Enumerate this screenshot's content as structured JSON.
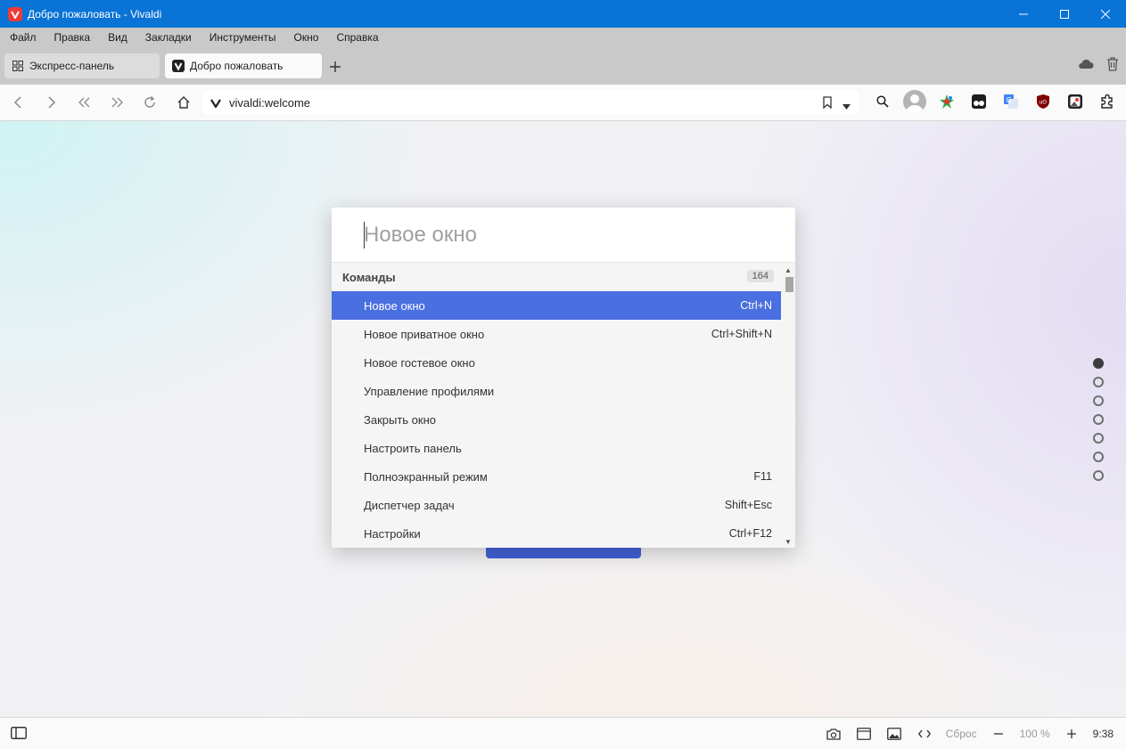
{
  "window": {
    "title": "Добро пожаловать - Vivaldi"
  },
  "menu": [
    "Файл",
    "Правка",
    "Вид",
    "Закладки",
    "Инструменты",
    "Окно",
    "Справка"
  ],
  "tabs": [
    {
      "label": "Экспресс-панель",
      "active": false
    },
    {
      "label": "Добро пожаловать",
      "active": true
    }
  ],
  "address": {
    "url": "vivaldi:welcome"
  },
  "quick_commands": {
    "placeholder": "Новое окно",
    "section_title": "Команды",
    "count": "164",
    "items": [
      {
        "label": "Новое окно",
        "shortcut": "Ctrl+N",
        "selected": true
      },
      {
        "label": "Новое приватное окно",
        "shortcut": "Ctrl+Shift+N"
      },
      {
        "label": "Новое гостевое окно",
        "shortcut": ""
      },
      {
        "label": "Управление профилями",
        "shortcut": ""
      },
      {
        "label": "Закрыть окно",
        "shortcut": ""
      },
      {
        "label": "Настроить панель",
        "shortcut": ""
      },
      {
        "label": "Полноэкранный режим",
        "shortcut": "F11"
      },
      {
        "label": "Диспетчер задач",
        "shortcut": "Shift+Esc"
      },
      {
        "label": "Настройки",
        "shortcut": "Ctrl+F12"
      }
    ]
  },
  "page_dots": {
    "count": 7,
    "active_index": 0
  },
  "statusbar": {
    "reset_label": "Сброс",
    "zoom": "100 %",
    "clock": "9:38"
  },
  "colors": {
    "titlebar": "#0a73d6",
    "selection": "#4a6fe0",
    "vivaldi_red": "#ef3939"
  }
}
